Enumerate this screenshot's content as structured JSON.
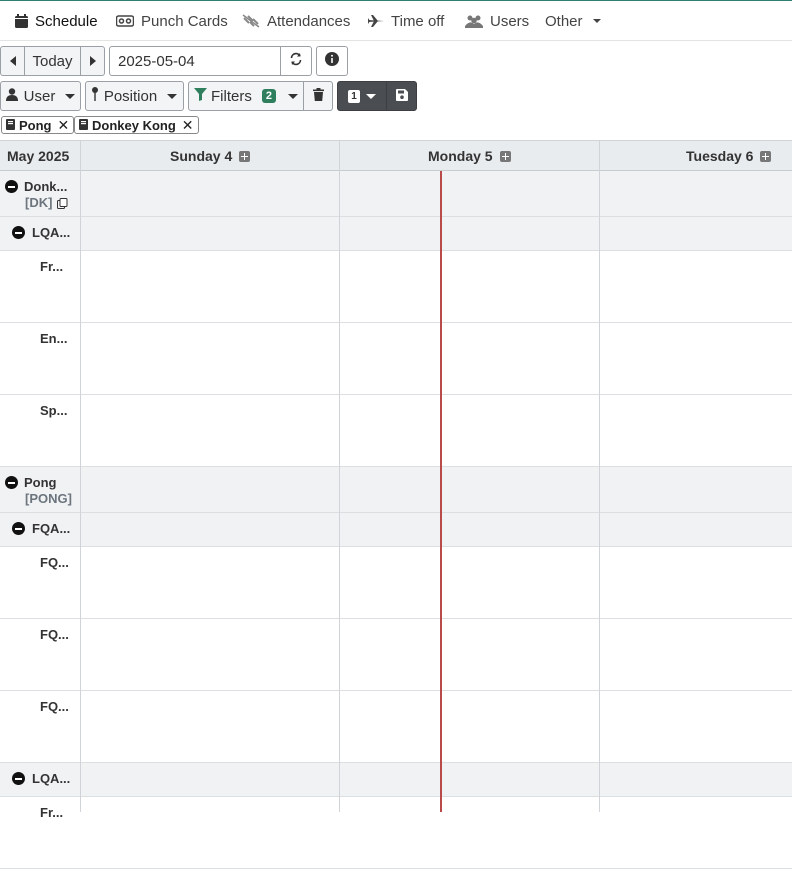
{
  "nav": {
    "items": [
      {
        "label": "Schedule",
        "icon": "calendar-icon"
      },
      {
        "label": "Punch Cards",
        "icon": "tape-icon"
      },
      {
        "label": "Attendances",
        "icon": "unlink-icon"
      },
      {
        "label": "Time off",
        "icon": "plane-icon"
      },
      {
        "label": "Users",
        "icon": "users-icon"
      },
      {
        "label": "Other",
        "icon": "caret-down-icon"
      }
    ]
  },
  "toolbar": {
    "today_label": "Today",
    "date_value": "2025-05-04",
    "user_label": "User",
    "position_label": "Position",
    "filters_label": "Filters",
    "filters_count": "2",
    "views_count": "1"
  },
  "chips": [
    {
      "label": "Pong"
    },
    {
      "label": "Donkey Kong"
    }
  ],
  "grid": {
    "month_label": "May 2025",
    "columns": [
      {
        "label": "Sunday 4"
      },
      {
        "label": "Monday 5"
      },
      {
        "label": "Tuesday 6"
      }
    ],
    "rows": {
      "r1": {
        "label": "Donk...",
        "sub": "[DK]"
      },
      "r2": {
        "label": "LQA..."
      },
      "r3": {
        "label": "Fr..."
      },
      "r4": {
        "label": "En..."
      },
      "r5": {
        "label": "Sp..."
      },
      "r6": {
        "label": "Pong",
        "sub": "[PONG]"
      },
      "r7": {
        "label": "FQA..."
      },
      "r8": {
        "label": "FQ..."
      },
      "r9": {
        "label": "FQ..."
      },
      "r10": {
        "label": "FQ..."
      },
      "r11": {
        "label": "LQA..."
      },
      "r12": {
        "label": "Fr..."
      }
    }
  },
  "colors": {
    "accent": "#2f7f5f",
    "now_line": "#b94a4a",
    "header_bg": "#e9ecef"
  }
}
